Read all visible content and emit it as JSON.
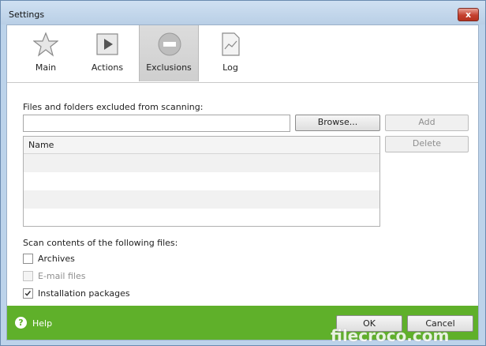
{
  "window": {
    "title": "Settings",
    "close_label": "x"
  },
  "tabs": [
    {
      "label": "Main",
      "icon": "star-icon",
      "active": false
    },
    {
      "label": "Actions",
      "icon": "play-icon",
      "active": false
    },
    {
      "label": "Exclusions",
      "icon": "minus-circle-icon",
      "active": true
    },
    {
      "label": "Log",
      "icon": "chart-document-icon",
      "active": false
    }
  ],
  "exclusions": {
    "section_label": "Files and folders excluded from scanning:",
    "path_value": "",
    "browse_label": "Browse...",
    "add_label": "Add",
    "delete_label": "Delete",
    "list": {
      "column_name": "Name",
      "rows": []
    }
  },
  "scan": {
    "section_label": "Scan contents of the following files:",
    "options": [
      {
        "label": "Archives",
        "checked": false,
        "enabled": true
      },
      {
        "label": "E-mail files",
        "checked": false,
        "enabled": false
      },
      {
        "label": "Installation packages",
        "checked": true,
        "enabled": true
      }
    ]
  },
  "footer": {
    "help_label": "Help",
    "ok_label": "OK",
    "cancel_label": "Cancel"
  },
  "watermark": {
    "text": "filecroco.com"
  },
  "colors": {
    "footer_green": "#5fb02a",
    "active_tab": "#d4d4d4"
  }
}
